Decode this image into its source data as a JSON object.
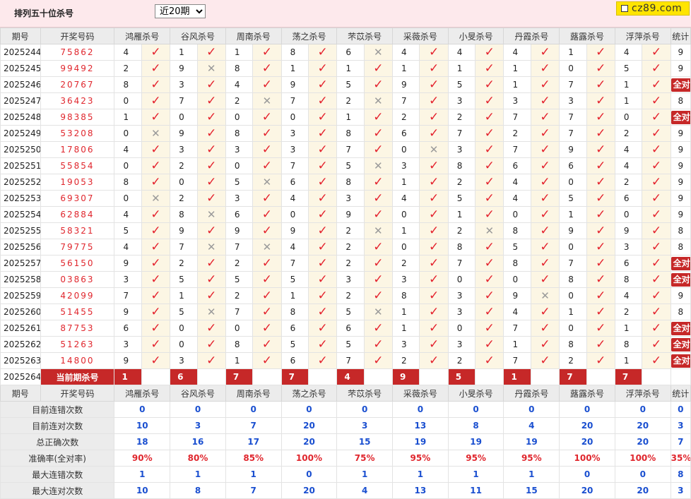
{
  "header": {
    "title": "排列五十位杀号",
    "period_select": {
      "selected": "近20期",
      "options": [
        "近20期"
      ]
    },
    "logo_text": "cz89.com"
  },
  "columns": {
    "issue": "期号",
    "winning": "开奖号码",
    "kill_groups": [
      "鸿雁杀号",
      "谷风杀号",
      "周南杀号",
      "荡之杀号",
      "芣苡杀号",
      "采薇杀号",
      "小旻杀号",
      "丹霞杀号",
      "蕗露杀号",
      "浮萍杀号"
    ],
    "stat": "统计"
  },
  "all_correct_label": "全对",
  "rows": [
    {
      "issue": "2025244",
      "win": "75862",
      "kills": [
        [
          4,
          1
        ],
        [
          1,
          1
        ],
        [
          1,
          1
        ],
        [
          8,
          1
        ],
        [
          6,
          0
        ],
        [
          4,
          1
        ],
        [
          4,
          1
        ],
        [
          4,
          1
        ],
        [
          1,
          1
        ],
        [
          4,
          1
        ]
      ],
      "stat": "9"
    },
    {
      "issue": "2025245",
      "win": "99492",
      "kills": [
        [
          2,
          1
        ],
        [
          9,
          0
        ],
        [
          8,
          1
        ],
        [
          1,
          1
        ],
        [
          1,
          1
        ],
        [
          1,
          1
        ],
        [
          1,
          1
        ],
        [
          1,
          1
        ],
        [
          0,
          1
        ],
        [
          5,
          1
        ]
      ],
      "stat": "9"
    },
    {
      "issue": "2025246",
      "win": "20767",
      "kills": [
        [
          8,
          1
        ],
        [
          3,
          1
        ],
        [
          4,
          1
        ],
        [
          9,
          1
        ],
        [
          5,
          1
        ],
        [
          9,
          1
        ],
        [
          5,
          1
        ],
        [
          1,
          1
        ],
        [
          7,
          1
        ],
        [
          1,
          1
        ]
      ],
      "stat": "全对"
    },
    {
      "issue": "2025247",
      "win": "36423",
      "kills": [
        [
          0,
          1
        ],
        [
          7,
          1
        ],
        [
          2,
          0
        ],
        [
          7,
          1
        ],
        [
          2,
          0
        ],
        [
          7,
          1
        ],
        [
          3,
          1
        ],
        [
          3,
          1
        ],
        [
          3,
          1
        ],
        [
          1,
          1
        ]
      ],
      "stat": "8"
    },
    {
      "issue": "2025248",
      "win": "98385",
      "kills": [
        [
          1,
          1
        ],
        [
          0,
          1
        ],
        [
          0,
          1
        ],
        [
          0,
          1
        ],
        [
          1,
          1
        ],
        [
          2,
          1
        ],
        [
          2,
          1
        ],
        [
          7,
          1
        ],
        [
          7,
          1
        ],
        [
          0,
          1
        ]
      ],
      "stat": "全对"
    },
    {
      "issue": "2025249",
      "win": "53208",
      "kills": [
        [
          0,
          0
        ],
        [
          9,
          1
        ],
        [
          8,
          1
        ],
        [
          3,
          1
        ],
        [
          8,
          1
        ],
        [
          6,
          1
        ],
        [
          7,
          1
        ],
        [
          2,
          1
        ],
        [
          7,
          1
        ],
        [
          2,
          1
        ]
      ],
      "stat": "9"
    },
    {
      "issue": "2025250",
      "win": "17806",
      "kills": [
        [
          4,
          1
        ],
        [
          3,
          1
        ],
        [
          3,
          1
        ],
        [
          3,
          1
        ],
        [
          7,
          1
        ],
        [
          0,
          0
        ],
        [
          3,
          1
        ],
        [
          7,
          1
        ],
        [
          9,
          1
        ],
        [
          4,
          1
        ]
      ],
      "stat": "9"
    },
    {
      "issue": "2025251",
      "win": "55854",
      "kills": [
        [
          0,
          1
        ],
        [
          2,
          1
        ],
        [
          0,
          1
        ],
        [
          7,
          1
        ],
        [
          5,
          0
        ],
        [
          3,
          1
        ],
        [
          8,
          1
        ],
        [
          6,
          1
        ],
        [
          6,
          1
        ],
        [
          4,
          1
        ]
      ],
      "stat": "9"
    },
    {
      "issue": "2025252",
      "win": "19053",
      "kills": [
        [
          8,
          1
        ],
        [
          0,
          1
        ],
        [
          5,
          0
        ],
        [
          6,
          1
        ],
        [
          8,
          1
        ],
        [
          1,
          1
        ],
        [
          2,
          1
        ],
        [
          4,
          1
        ],
        [
          0,
          1
        ],
        [
          2,
          1
        ]
      ],
      "stat": "9"
    },
    {
      "issue": "2025253",
      "win": "69307",
      "kills": [
        [
          0,
          0
        ],
        [
          2,
          1
        ],
        [
          3,
          1
        ],
        [
          4,
          1
        ],
        [
          3,
          1
        ],
        [
          4,
          1
        ],
        [
          5,
          1
        ],
        [
          4,
          1
        ],
        [
          5,
          1
        ],
        [
          6,
          1
        ]
      ],
      "stat": "9"
    },
    {
      "issue": "2025254",
      "win": "62884",
      "kills": [
        [
          4,
          1
        ],
        [
          8,
          0
        ],
        [
          6,
          1
        ],
        [
          0,
          1
        ],
        [
          9,
          1
        ],
        [
          0,
          1
        ],
        [
          1,
          1
        ],
        [
          0,
          1
        ],
        [
          1,
          1
        ],
        [
          0,
          1
        ]
      ],
      "stat": "9"
    },
    {
      "issue": "2025255",
      "win": "58321",
      "kills": [
        [
          5,
          1
        ],
        [
          9,
          1
        ],
        [
          9,
          1
        ],
        [
          9,
          1
        ],
        [
          2,
          0
        ],
        [
          1,
          1
        ],
        [
          2,
          0
        ],
        [
          8,
          1
        ],
        [
          9,
          1
        ],
        [
          9,
          1
        ]
      ],
      "stat": "8"
    },
    {
      "issue": "2025256",
      "win": "79775",
      "kills": [
        [
          4,
          1
        ],
        [
          7,
          0
        ],
        [
          7,
          0
        ],
        [
          4,
          1
        ],
        [
          2,
          1
        ],
        [
          0,
          1
        ],
        [
          8,
          1
        ],
        [
          5,
          1
        ],
        [
          0,
          1
        ],
        [
          3,
          1
        ]
      ],
      "stat": "8"
    },
    {
      "issue": "2025257",
      "win": "56150",
      "kills": [
        [
          9,
          1
        ],
        [
          2,
          1
        ],
        [
          2,
          1
        ],
        [
          7,
          1
        ],
        [
          2,
          1
        ],
        [
          2,
          1
        ],
        [
          7,
          1
        ],
        [
          8,
          1
        ],
        [
          7,
          1
        ],
        [
          6,
          1
        ]
      ],
      "stat": "全对"
    },
    {
      "issue": "2025258",
      "win": "03863",
      "kills": [
        [
          3,
          1
        ],
        [
          5,
          1
        ],
        [
          5,
          1
        ],
        [
          5,
          1
        ],
        [
          3,
          1
        ],
        [
          3,
          1
        ],
        [
          0,
          1
        ],
        [
          0,
          1
        ],
        [
          8,
          1
        ],
        [
          8,
          1
        ]
      ],
      "stat": "全对"
    },
    {
      "issue": "2025259",
      "win": "42099",
      "kills": [
        [
          7,
          1
        ],
        [
          1,
          1
        ],
        [
          2,
          1
        ],
        [
          1,
          1
        ],
        [
          2,
          1
        ],
        [
          8,
          1
        ],
        [
          3,
          1
        ],
        [
          9,
          0
        ],
        [
          0,
          1
        ],
        [
          4,
          1
        ]
      ],
      "stat": "9"
    },
    {
      "issue": "2025260",
      "win": "51455",
      "kills": [
        [
          9,
          1
        ],
        [
          5,
          0
        ],
        [
          7,
          1
        ],
        [
          8,
          1
        ],
        [
          5,
          0
        ],
        [
          1,
          1
        ],
        [
          3,
          1
        ],
        [
          4,
          1
        ],
        [
          1,
          1
        ],
        [
          2,
          1
        ]
      ],
      "stat": "8"
    },
    {
      "issue": "2025261",
      "win": "87753",
      "kills": [
        [
          6,
          1
        ],
        [
          0,
          1
        ],
        [
          0,
          1
        ],
        [
          6,
          1
        ],
        [
          6,
          1
        ],
        [
          1,
          1
        ],
        [
          0,
          1
        ],
        [
          7,
          1
        ],
        [
          0,
          1
        ],
        [
          1,
          1
        ]
      ],
      "stat": "全对"
    },
    {
      "issue": "2025262",
      "win": "51263",
      "kills": [
        [
          3,
          1
        ],
        [
          0,
          1
        ],
        [
          8,
          1
        ],
        [
          5,
          1
        ],
        [
          5,
          1
        ],
        [
          3,
          1
        ],
        [
          3,
          1
        ],
        [
          1,
          1
        ],
        [
          8,
          1
        ],
        [
          8,
          1
        ]
      ],
      "stat": "全对"
    },
    {
      "issue": "2025263",
      "win": "14800",
      "kills": [
        [
          9,
          1
        ],
        [
          3,
          1
        ],
        [
          1,
          1
        ],
        [
          6,
          1
        ],
        [
          7,
          1
        ],
        [
          2,
          1
        ],
        [
          2,
          1
        ],
        [
          7,
          1
        ],
        [
          2,
          1
        ],
        [
          1,
          1
        ]
      ],
      "stat": "全对"
    }
  ],
  "prediction": {
    "issue": "2025264",
    "label": "当前期杀号",
    "values": [
      "1",
      "6",
      "7",
      "7",
      "4",
      "9",
      "5",
      "1",
      "7",
      "7"
    ]
  },
  "stats_rows": [
    {
      "label": "目前连错次数",
      "values": [
        "0",
        "0",
        "0",
        "0",
        "0",
        "0",
        "0",
        "0",
        "0",
        "0"
      ],
      "stat": "0"
    },
    {
      "label": "目前连对次数",
      "values": [
        "10",
        "3",
        "7",
        "20",
        "3",
        "13",
        "8",
        "4",
        "20",
        "20"
      ],
      "stat": "3"
    },
    {
      "label": "总正确次数",
      "values": [
        "18",
        "16",
        "17",
        "20",
        "15",
        "19",
        "19",
        "19",
        "20",
        "20"
      ],
      "stat": "7"
    },
    {
      "label": "准确率(全对率)",
      "values": [
        "90%",
        "80%",
        "85%",
        "100%",
        "75%",
        "95%",
        "95%",
        "95%",
        "100%",
        "100%"
      ],
      "stat": "35%"
    },
    {
      "label": "最大连错次数",
      "values": [
        "1",
        "1",
        "1",
        "0",
        "1",
        "1",
        "1",
        "1",
        "0",
        "0"
      ],
      "stat": "8"
    },
    {
      "label": "最大连对次数",
      "values": [
        "10",
        "8",
        "7",
        "20",
        "4",
        "13",
        "11",
        "15",
        "20",
        "20"
      ],
      "stat": "3"
    }
  ],
  "colors": {
    "accent": "#c62828",
    "win_number": "#e0262d",
    "stat_blue": "#1a4fd0",
    "header_bg": "#ececec",
    "mark_bg": "#fcf6e4",
    "top_bg": "#fde9ec",
    "logo_bg": "#ffe400"
  }
}
